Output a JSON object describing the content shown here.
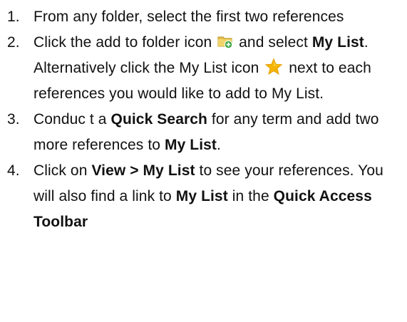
{
  "steps": [
    {
      "number": "1.",
      "text": "From any folder, select the first two references"
    },
    {
      "number": "2.",
      "text_a": "Click the add to folder icon",
      "icon_a": "add-to-folder-icon",
      "text_b": "and select",
      "bold_b": "My List",
      "text_c": ". Alternatively click the My List icon",
      "icon_b": "my-list-star-icon",
      "text_d": "next to each references you would like to add to My List."
    },
    {
      "number": "3.",
      "text_a": "Conduc t a",
      "bold_a": "Quick Search",
      "text_b": "for any term and add two more references to",
      "bold_b": "My List",
      "text_c": "."
    },
    {
      "number": "4.",
      "text_a": "Click on",
      "bold_a": "View > My List",
      "text_b": "to see your references. You will also find a link to",
      "bold_b": "My List",
      "text_c": "in the",
      "bold_c": "Quick Access Toolbar"
    }
  ],
  "colors": {
    "text": "#111111",
    "folder": "#e8c24a",
    "folder_badge": "#3aa640",
    "star": "#f5b400"
  }
}
